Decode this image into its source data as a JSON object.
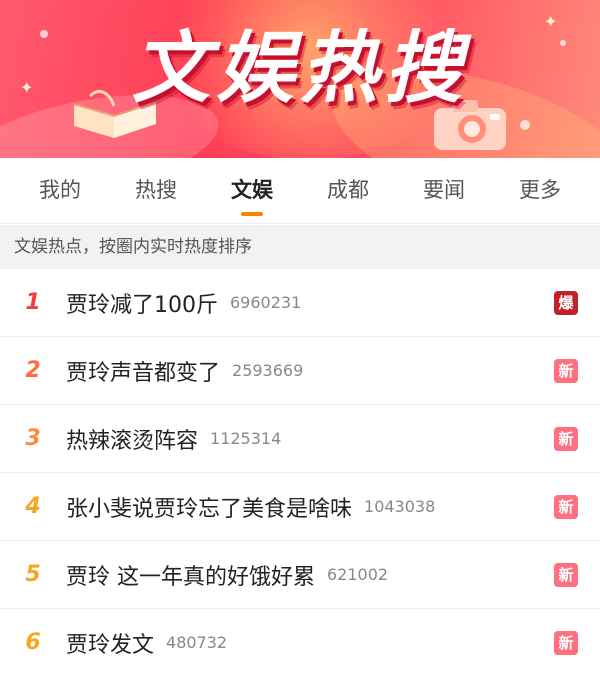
{
  "banner": {
    "title": "文娱热搜"
  },
  "tabs": [
    {
      "label": "我的",
      "active": false
    },
    {
      "label": "热搜",
      "active": false
    },
    {
      "label": "文娱",
      "active": true
    },
    {
      "label": "成都",
      "active": false
    },
    {
      "label": "要闻",
      "active": false
    },
    {
      "label": "更多",
      "active": false
    }
  ],
  "subheader": "文娱热点，按圈内实时热度排序",
  "items": [
    {
      "rank": "1",
      "title": "贾玲减了100斤",
      "count": "6960231",
      "badge": "爆",
      "rank_color": "#f03e3e",
      "badge_color": "#c2212a"
    },
    {
      "rank": "2",
      "title": "贾玲声音都变了",
      "count": "2593669",
      "badge": "新",
      "rank_color": "#ff6d3a",
      "badge_color": "#ff6f7f"
    },
    {
      "rank": "3",
      "title": "热辣滚烫阵容",
      "count": "1125314",
      "badge": "新",
      "rank_color": "#ff8a3d",
      "badge_color": "#ff6f7f"
    },
    {
      "rank": "4",
      "title": "张小斐说贾玲忘了美食是啥味",
      "count": "1043038",
      "badge": "新",
      "rank_color": "#f5a623",
      "badge_color": "#ff6f7f"
    },
    {
      "rank": "5",
      "title": "贾玲 这一年真的好饿好累",
      "count": "621002",
      "badge": "新",
      "rank_color": "#f5a623",
      "badge_color": "#ff6f7f"
    },
    {
      "rank": "6",
      "title": "贾玲发文",
      "count": "480732",
      "badge": "新",
      "rank_color": "#f5a623",
      "badge_color": "#ff6f7f"
    }
  ]
}
